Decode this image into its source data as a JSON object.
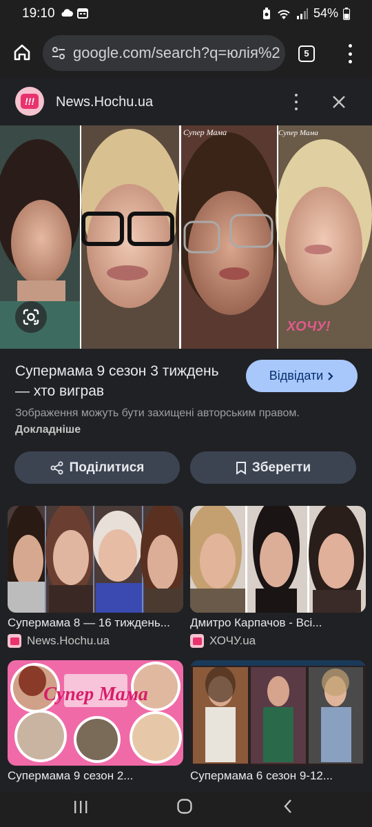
{
  "status_bar": {
    "time": "19:10",
    "battery": "54%"
  },
  "browser": {
    "url": "google.com/search?q=юлія%2",
    "tab_count": "5"
  },
  "source": {
    "name": "News.Hochu.ua"
  },
  "hero_image": {
    "overlay_logo": "Супер Мама",
    "watermark": "ХОЧУ!"
  },
  "result": {
    "title": "Супермама 9 сезон 3 тиждень — хто виграв",
    "visit_label": "Відвідати",
    "copyright_text": "Зображення можуть бути захищені авторським правом.",
    "learn_more": "Докладніше"
  },
  "actions": {
    "share_label": "Поділитися",
    "save_label": "Зберегти"
  },
  "related": [
    {
      "caption": "Супермама 8 — 16 тиждень...",
      "site": "News.Hochu.ua"
    },
    {
      "caption": "Дмитро Карпачов - Всі...",
      "site": "ХОЧУ.ua"
    },
    {
      "caption": "Супермама 9 сезон 2...",
      "thumb_logo": "Супер Мама"
    },
    {
      "caption": "Супермама 6 сезон 9-12..."
    }
  ],
  "colors": {
    "background": "#202124",
    "visit_button": "#a8c7fa",
    "action_button": "#3c4452",
    "brand_pink": "#e8336e"
  }
}
